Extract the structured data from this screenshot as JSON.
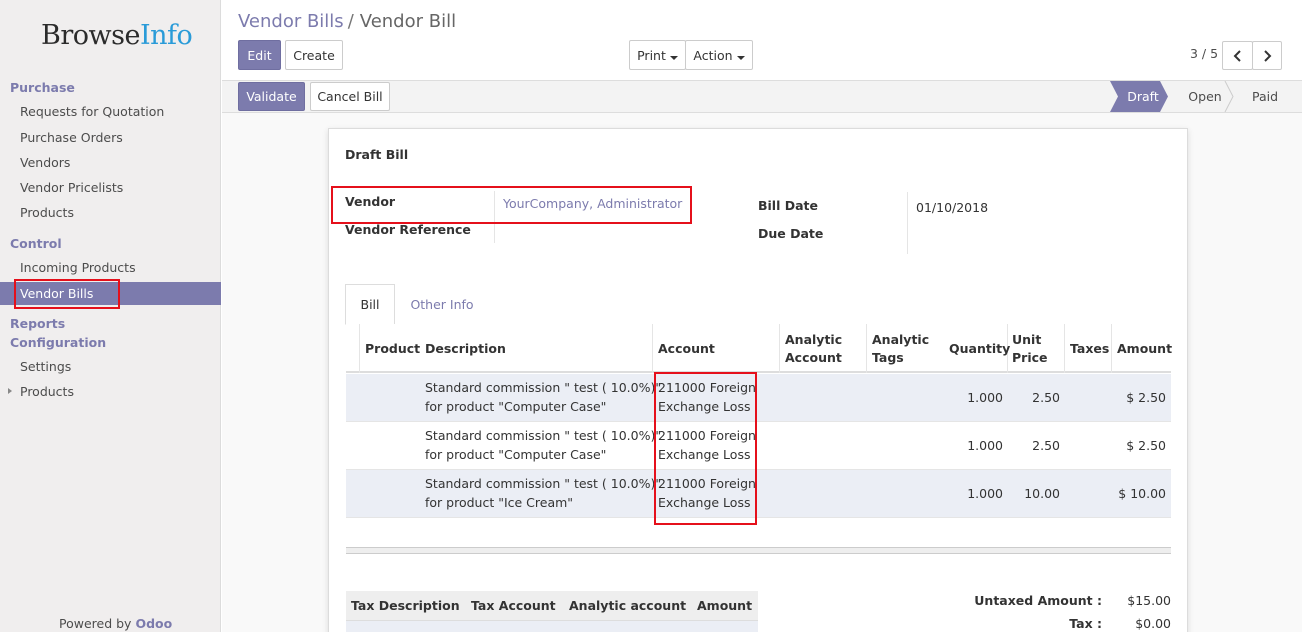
{
  "brand": {
    "part1": "Browse",
    "part2": "Info"
  },
  "sidebar": {
    "sections": [
      {
        "title": "Purchase",
        "items": [
          "Requests for Quotation",
          "Purchase Orders",
          "Vendors",
          "Vendor Pricelists",
          "Products"
        ]
      },
      {
        "title": "Control",
        "items": [
          "Incoming Products",
          "Vendor Bills"
        ]
      },
      {
        "title": "Reports",
        "items": []
      },
      {
        "title": "Configuration",
        "items": [
          "Settings",
          "Products"
        ]
      }
    ],
    "active_item": "Vendor Bills",
    "powered_by": "Powered by",
    "powered_brand": "Odoo"
  },
  "breadcrumb": {
    "parent": "Vendor Bills",
    "separator": "/",
    "current": "Vendor Bill"
  },
  "toolbar": {
    "edit": "Edit",
    "create": "Create",
    "print": "Print",
    "action": "Action"
  },
  "pager": {
    "text": "3 / 5",
    "prev_icon": "chevron-left-icon",
    "next_icon": "chevron-right-icon"
  },
  "statusbar": {
    "validate": "Validate",
    "cancel": "Cancel Bill",
    "stages": [
      "Draft",
      "Open",
      "Paid"
    ],
    "active_stage": "Draft"
  },
  "form": {
    "title": "Draft Bill",
    "vendor_label": "Vendor",
    "vendor_value": "YourCompany, Administrator",
    "vendor_ref_label": "Vendor Reference",
    "vendor_ref_value": "",
    "bill_date_label": "Bill Date",
    "bill_date_value": "01/10/2018",
    "due_date_label": "Due Date",
    "due_date_value": ""
  },
  "tabs": [
    "Bill",
    "Other Info"
  ],
  "lines": {
    "headers": {
      "product": "Product",
      "description": "Description",
      "account": "Account",
      "analytic_account_1": "Analytic",
      "analytic_account_2": "Account",
      "analytic_tags_1": "Analytic",
      "analytic_tags_2": "Tags",
      "quantity": "Quantity",
      "unit_price_1": "Unit",
      "unit_price_2": "Price",
      "taxes": "Taxes",
      "amount": "Amount"
    },
    "rows": [
      {
        "desc1": "Standard commission \" test ( 10.0%)\"",
        "desc2": "for product \"Computer Case\"",
        "acc1": "211000 Foreign",
        "acc2": "Exchange Loss",
        "qty": "1.000",
        "price": "2.50",
        "amount": "$ 2.50"
      },
      {
        "desc1": "Standard commission \" test ( 10.0%)\"",
        "desc2": "for product \"Computer Case\"",
        "acc1": "211000 Foreign",
        "acc2": "Exchange Loss",
        "qty": "1.000",
        "price": "2.50",
        "amount": "$ 2.50"
      },
      {
        "desc1": "Standard commission \" test ( 10.0%)\"",
        "desc2": "for product \"Ice Cream\"",
        "acc1": "211000 Foreign",
        "acc2": "Exchange Loss",
        "qty": "1.000",
        "price": "10.00",
        "amount": "$ 10.00"
      }
    ]
  },
  "tax_table": {
    "headers": [
      "Tax Description",
      "Tax Account",
      "Analytic account",
      "Amount"
    ]
  },
  "totals": {
    "untaxed_label": "Untaxed Amount :",
    "untaxed_value": "$15.00",
    "tax_label": "Tax :",
    "tax_value": "$0.00"
  },
  "colors": {
    "accent": "#7c7bad",
    "highlight": "#e5101b",
    "logo_blue": "#2a9bd8"
  }
}
